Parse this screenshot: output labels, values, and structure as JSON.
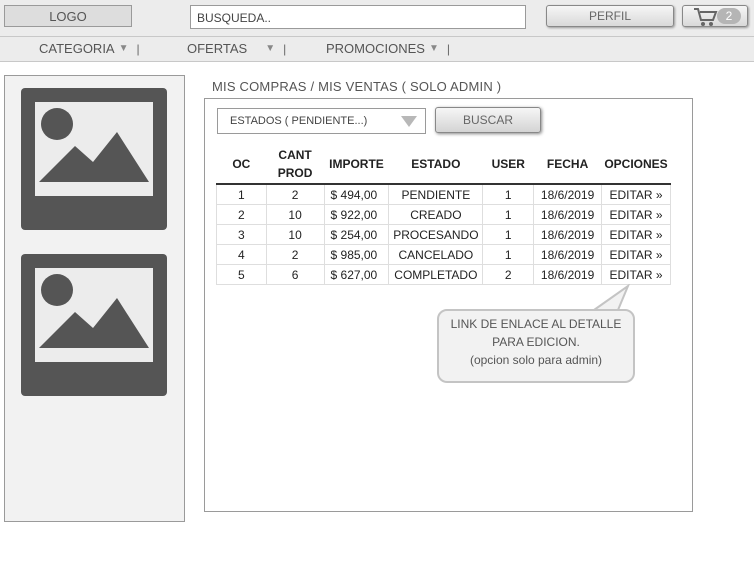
{
  "header": {
    "logo": "LOGO",
    "search_value": "BUSQUEDA..",
    "profile_label": "PERFIL",
    "cart_count": "2"
  },
  "nav": {
    "items": [
      {
        "label": "CATEGORIA"
      },
      {
        "label": "OFERTAS"
      },
      {
        "label": "PROMOCIONES"
      }
    ],
    "separator": "|"
  },
  "main": {
    "title": "MIS COMPRAS  / MIS VENTAS  ( SOLO ADMIN )",
    "filter_select": "ESTADOS  ( PENDIENTE...)",
    "search_button": "BUSCAR"
  },
  "table": {
    "headers": [
      "OC",
      "CANT PROD",
      "IMPORTE",
      "ESTADO",
      "USER",
      "FECHA",
      "OPCIONES"
    ],
    "rows": [
      [
        "1",
        "2",
        "$ 494,00",
        "PENDIENTE",
        "1",
        "18/6/2019",
        "EDITAR »"
      ],
      [
        "2",
        "10",
        "$ 922,00",
        "CREADO",
        "1",
        "18/6/2019",
        "EDITAR »"
      ],
      [
        "3",
        "10",
        "$ 254,00",
        "PROCESANDO",
        "1",
        "18/6/2019",
        "EDITAR »"
      ],
      [
        "4",
        "2",
        "$ 985,00",
        "CANCELADO",
        "1",
        "18/6/2019",
        "EDITAR »"
      ],
      [
        "5",
        "6",
        "$ 627,00",
        "COMPLETADO",
        "2",
        "18/6/2019",
        "EDITAR »"
      ]
    ]
  },
  "callout": {
    "line1": "LINK DE ENLACE AL DETALLE",
    "line2": "PARA EDICION.",
    "line3": "(opcion solo para admin)"
  },
  "icons": {
    "cart": "cart-icon",
    "dropdown": "chevron-down-icon",
    "image": "image-placeholder-icon"
  },
  "colors": {
    "header_bg": "#ececec",
    "placeholder_dark": "#555555",
    "border": "#9a9a9a"
  }
}
